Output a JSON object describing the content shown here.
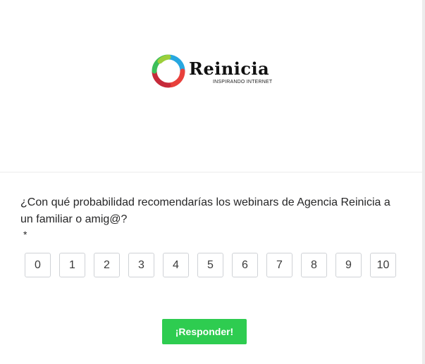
{
  "logo": {
    "wordmark": "Reinicia",
    "tagline": "INSPIRANDO INTERNET"
  },
  "question": {
    "text": "¿Con qué probabilidad recomendarías los webinars de Agencia Reinicia a un familiar o amig@?",
    "required_marker": "*"
  },
  "scale": {
    "options": [
      "0",
      "1",
      "2",
      "3",
      "4",
      "5",
      "6",
      "7",
      "8",
      "9",
      "10"
    ]
  },
  "submit": {
    "label": "¡Responder!"
  },
  "colors": {
    "submit_bg": "#2ecc50",
    "option_border": "#cfd2d6",
    "text": "#262627"
  }
}
